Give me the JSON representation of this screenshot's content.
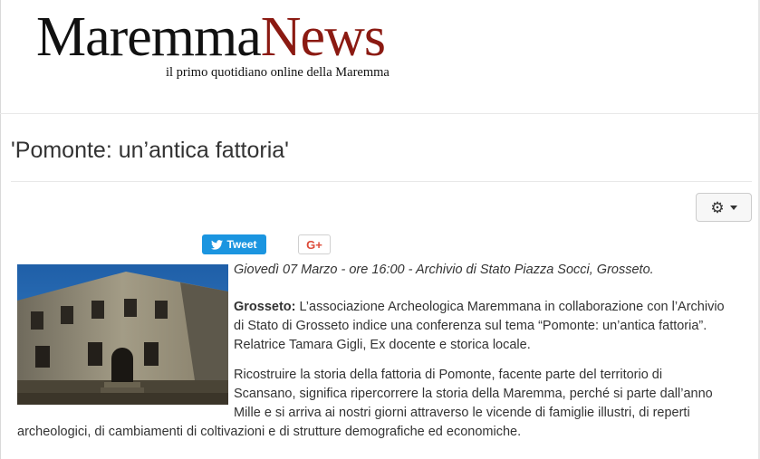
{
  "header": {
    "logo_part1": "Maremma",
    "logo_part2": "News",
    "tagline": "il primo quotidiano online della Maremma"
  },
  "article": {
    "title": "'Pomonte: un’antica fattoria'",
    "date_line": "Giovedì 07 Marzo - ore 16:00 - Archivio di Stato Piazza Socci, Grosseto.",
    "p1_lead": "Grosseto:",
    "p1_lines": [
      " L’associazione Archeologica Maremmana in collaborazione con l’Archivio",
      "di Stato di Grosseto indice una conferenza sul tema “Pomonte: un’antica fattoria”.",
      "Relatrice Tamara Gigli, Ex docente e storica locale."
    ],
    "p2_lines": [
      "Ricostruire la storia della fattoria di Pomonte, facente parte del territorio di",
      "Scansano, significa ripercorrere la storia della Maremma, perché si parte dall’anno",
      "Mille e si arriva ai nostri giorni attraverso le vicende di famiglie illustri, di reperti",
      "archeologici, di cambiamenti di coltivazioni e di strutture demografiche ed economiche."
    ]
  },
  "share": {
    "tweet_label": "Tweet",
    "gplus_label": "G+"
  },
  "icons": {
    "tools": "gear-icon",
    "tweet": "twitter-bird-icon",
    "gplus": "google-plus-icon"
  },
  "colors": {
    "logo_accent": "#8b1a12",
    "twitter_blue": "#1b95e0",
    "gplus_red": "#dd4b39"
  }
}
